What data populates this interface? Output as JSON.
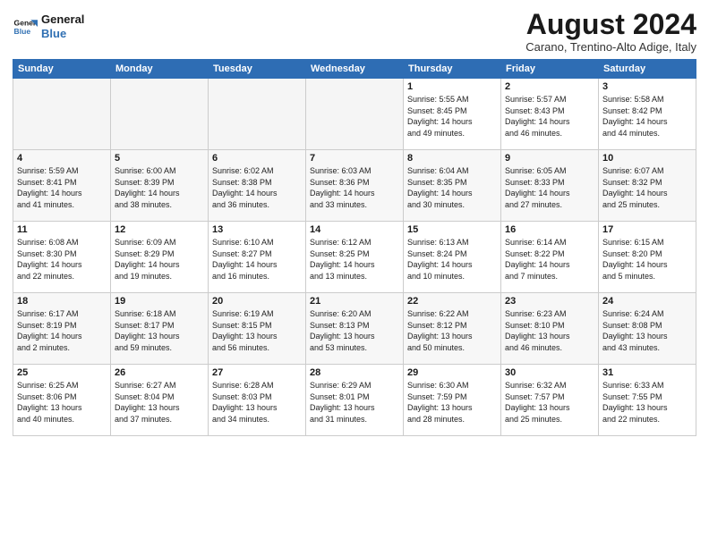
{
  "header": {
    "logo_line1": "General",
    "logo_line2": "Blue",
    "month_year": "August 2024",
    "location": "Carano, Trentino-Alto Adige, Italy"
  },
  "weekdays": [
    "Sunday",
    "Monday",
    "Tuesday",
    "Wednesday",
    "Thursday",
    "Friday",
    "Saturday"
  ],
  "weeks": [
    [
      {
        "day": "",
        "info": "",
        "empty": true
      },
      {
        "day": "",
        "info": "",
        "empty": true
      },
      {
        "day": "",
        "info": "",
        "empty": true
      },
      {
        "day": "",
        "info": "",
        "empty": true
      },
      {
        "day": "1",
        "info": "Sunrise: 5:55 AM\nSunset: 8:45 PM\nDaylight: 14 hours\nand 49 minutes."
      },
      {
        "day": "2",
        "info": "Sunrise: 5:57 AM\nSunset: 8:43 PM\nDaylight: 14 hours\nand 46 minutes."
      },
      {
        "day": "3",
        "info": "Sunrise: 5:58 AM\nSunset: 8:42 PM\nDaylight: 14 hours\nand 44 minutes."
      }
    ],
    [
      {
        "day": "4",
        "info": "Sunrise: 5:59 AM\nSunset: 8:41 PM\nDaylight: 14 hours\nand 41 minutes."
      },
      {
        "day": "5",
        "info": "Sunrise: 6:00 AM\nSunset: 8:39 PM\nDaylight: 14 hours\nand 38 minutes."
      },
      {
        "day": "6",
        "info": "Sunrise: 6:02 AM\nSunset: 8:38 PM\nDaylight: 14 hours\nand 36 minutes."
      },
      {
        "day": "7",
        "info": "Sunrise: 6:03 AM\nSunset: 8:36 PM\nDaylight: 14 hours\nand 33 minutes."
      },
      {
        "day": "8",
        "info": "Sunrise: 6:04 AM\nSunset: 8:35 PM\nDaylight: 14 hours\nand 30 minutes."
      },
      {
        "day": "9",
        "info": "Sunrise: 6:05 AM\nSunset: 8:33 PM\nDaylight: 14 hours\nand 27 minutes."
      },
      {
        "day": "10",
        "info": "Sunrise: 6:07 AM\nSunset: 8:32 PM\nDaylight: 14 hours\nand 25 minutes."
      }
    ],
    [
      {
        "day": "11",
        "info": "Sunrise: 6:08 AM\nSunset: 8:30 PM\nDaylight: 14 hours\nand 22 minutes."
      },
      {
        "day": "12",
        "info": "Sunrise: 6:09 AM\nSunset: 8:29 PM\nDaylight: 14 hours\nand 19 minutes."
      },
      {
        "day": "13",
        "info": "Sunrise: 6:10 AM\nSunset: 8:27 PM\nDaylight: 14 hours\nand 16 minutes."
      },
      {
        "day": "14",
        "info": "Sunrise: 6:12 AM\nSunset: 8:25 PM\nDaylight: 14 hours\nand 13 minutes."
      },
      {
        "day": "15",
        "info": "Sunrise: 6:13 AM\nSunset: 8:24 PM\nDaylight: 14 hours\nand 10 minutes."
      },
      {
        "day": "16",
        "info": "Sunrise: 6:14 AM\nSunset: 8:22 PM\nDaylight: 14 hours\nand 7 minutes."
      },
      {
        "day": "17",
        "info": "Sunrise: 6:15 AM\nSunset: 8:20 PM\nDaylight: 14 hours\nand 5 minutes."
      }
    ],
    [
      {
        "day": "18",
        "info": "Sunrise: 6:17 AM\nSunset: 8:19 PM\nDaylight: 14 hours\nand 2 minutes."
      },
      {
        "day": "19",
        "info": "Sunrise: 6:18 AM\nSunset: 8:17 PM\nDaylight: 13 hours\nand 59 minutes."
      },
      {
        "day": "20",
        "info": "Sunrise: 6:19 AM\nSunset: 8:15 PM\nDaylight: 13 hours\nand 56 minutes."
      },
      {
        "day": "21",
        "info": "Sunrise: 6:20 AM\nSunset: 8:13 PM\nDaylight: 13 hours\nand 53 minutes."
      },
      {
        "day": "22",
        "info": "Sunrise: 6:22 AM\nSunset: 8:12 PM\nDaylight: 13 hours\nand 50 minutes."
      },
      {
        "day": "23",
        "info": "Sunrise: 6:23 AM\nSunset: 8:10 PM\nDaylight: 13 hours\nand 46 minutes."
      },
      {
        "day": "24",
        "info": "Sunrise: 6:24 AM\nSunset: 8:08 PM\nDaylight: 13 hours\nand 43 minutes."
      }
    ],
    [
      {
        "day": "25",
        "info": "Sunrise: 6:25 AM\nSunset: 8:06 PM\nDaylight: 13 hours\nand 40 minutes."
      },
      {
        "day": "26",
        "info": "Sunrise: 6:27 AM\nSunset: 8:04 PM\nDaylight: 13 hours\nand 37 minutes."
      },
      {
        "day": "27",
        "info": "Sunrise: 6:28 AM\nSunset: 8:03 PM\nDaylight: 13 hours\nand 34 minutes."
      },
      {
        "day": "28",
        "info": "Sunrise: 6:29 AM\nSunset: 8:01 PM\nDaylight: 13 hours\nand 31 minutes."
      },
      {
        "day": "29",
        "info": "Sunrise: 6:30 AM\nSunset: 7:59 PM\nDaylight: 13 hours\nand 28 minutes."
      },
      {
        "day": "30",
        "info": "Sunrise: 6:32 AM\nSunset: 7:57 PM\nDaylight: 13 hours\nand 25 minutes."
      },
      {
        "day": "31",
        "info": "Sunrise: 6:33 AM\nSunset: 7:55 PM\nDaylight: 13 hours\nand 22 minutes."
      }
    ]
  ]
}
